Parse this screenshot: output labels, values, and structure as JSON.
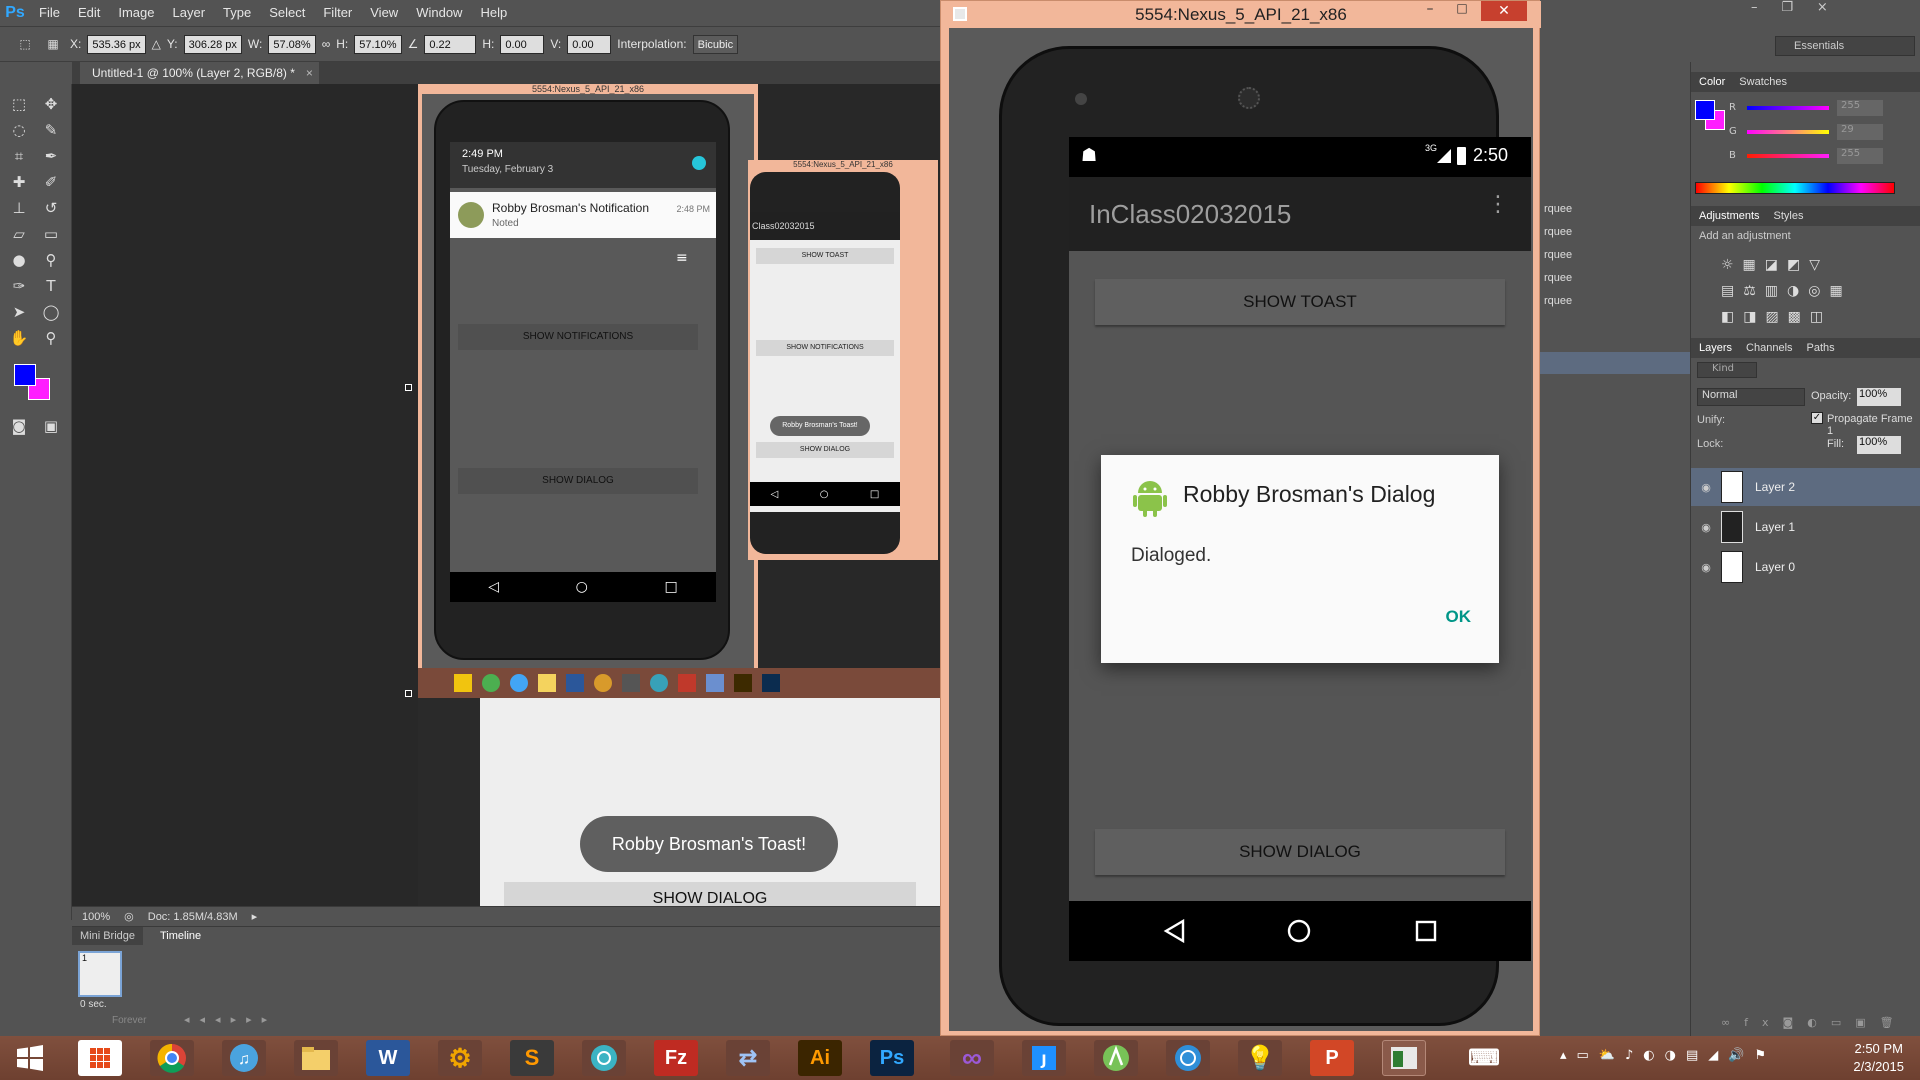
{
  "photoshop": {
    "logo": "Ps",
    "menu": [
      "File",
      "Edit",
      "Image",
      "Layer",
      "Type",
      "Select",
      "Filter",
      "View",
      "Window",
      "Help"
    ],
    "options": {
      "x_label": "X:",
      "x_value": "535.36 px",
      "y_label": "Y:",
      "y_value": "306.28 px",
      "w_label": "W:",
      "w_value": "57.08%",
      "h_label": "H:",
      "h_value": "57.10%",
      "angle_value": "0.22",
      "hskew_label": "H:",
      "hskew_value": "0.00",
      "vskew_label": "V:",
      "vskew_value": "0.00",
      "interp_label": "Interpolation:",
      "interp_value": "Bicubic"
    },
    "document_tab": "Untitled-1 @ 100% (Layer 2, RGB/8) *",
    "close_glyph": "×",
    "status": {
      "zoom": "100%",
      "doc": "Doc: 1.85M/4.83M"
    },
    "timeline": {
      "tabs": [
        "Mini Bridge",
        "Timeline"
      ],
      "frame_number": "1",
      "frame_delay": "0 sec.",
      "loop": "Forever"
    },
    "workspace": "Essentials",
    "color_panel": {
      "tabs": [
        "Color",
        "Swatches"
      ],
      "r_label": "R",
      "r_value": "255",
      "g_label": "G",
      "g_value": "29",
      "b_label": "B",
      "b_value": "255",
      "foreground": "#0000ff",
      "background": "#ff1dff"
    },
    "adjustments_panel": {
      "tabs": [
        "Adjustments",
        "Styles"
      ],
      "hint": "Add an adjustment"
    },
    "layers_panel": {
      "tabs": [
        "Layers",
        "Channels",
        "Paths"
      ],
      "kind": "Kind",
      "blend_mode": "Normal",
      "opacity_label": "Opacity:",
      "opacity_value": "100%",
      "unify_label": "Unify:",
      "propagate_label": "Propagate Frame 1",
      "lock_label": "Lock:",
      "fill_label": "Fill:",
      "fill_value": "100%",
      "layers": [
        {
          "name": "Layer 2"
        },
        {
          "name": "Layer 1"
        },
        {
          "name": "Layer 0"
        }
      ]
    },
    "side_strip_items": [
      "rquee",
      "rquee",
      "rquee",
      "rquee",
      "rquee"
    ]
  },
  "canvas_shot": {
    "title": "5554:Nexus_5_API_21_x86",
    "notif_time": "2:49 PM",
    "notif_date": "Tuesday, February 3",
    "notif_title": "Robby Brosman's Notification",
    "notif_sub": "Noted",
    "notif_stamp": "2:48 PM",
    "btn_notifications": "SHOW NOTIFICATIONS",
    "btn_dialog": "SHOW DIALOG",
    "small_title": "5554:Nexus_5_API_21_x86",
    "small_app": "Class02032015",
    "small_btn_toast": "SHOW TOAST",
    "small_btn_notif": "SHOW NOTIFICATIONS",
    "small_toast": "Robby Brosman's Toast!",
    "small_btn_dialog": "SHOW DIALOG",
    "big_toast": "Robby Brosman's Toast!",
    "big_btn_dialog": "SHOW DIALOG"
  },
  "emulator": {
    "window_title": "5554:Nexus_5_API_21_x86",
    "status_net": "3G",
    "status_time": "2:50",
    "app_title": "InClass02032015",
    "btn_toast": "SHOW TOAST",
    "btn_dialog": "SHOW DIALOG",
    "dialog": {
      "title": "Robby Brosman's Dialog",
      "message": "Dialoged.",
      "ok": "OK"
    }
  },
  "taskbar": {
    "apps": [
      "start",
      "apps-grid",
      "chrome",
      "itunes",
      "explorer",
      "word",
      "gear",
      "sublime",
      "network",
      "filezilla",
      "network-2",
      "illustrator",
      "photoshop",
      "visual-studio",
      "jetbrains",
      "android-studio",
      "browser-2",
      "lightbulb",
      "powerpoint",
      "emulator-window",
      "keyboard"
    ],
    "ai_label": "Ai",
    "ps_label": "Ps",
    "fz_label": "Fz",
    "clock_time": "2:50 PM",
    "clock_date": "2/3/2015"
  }
}
